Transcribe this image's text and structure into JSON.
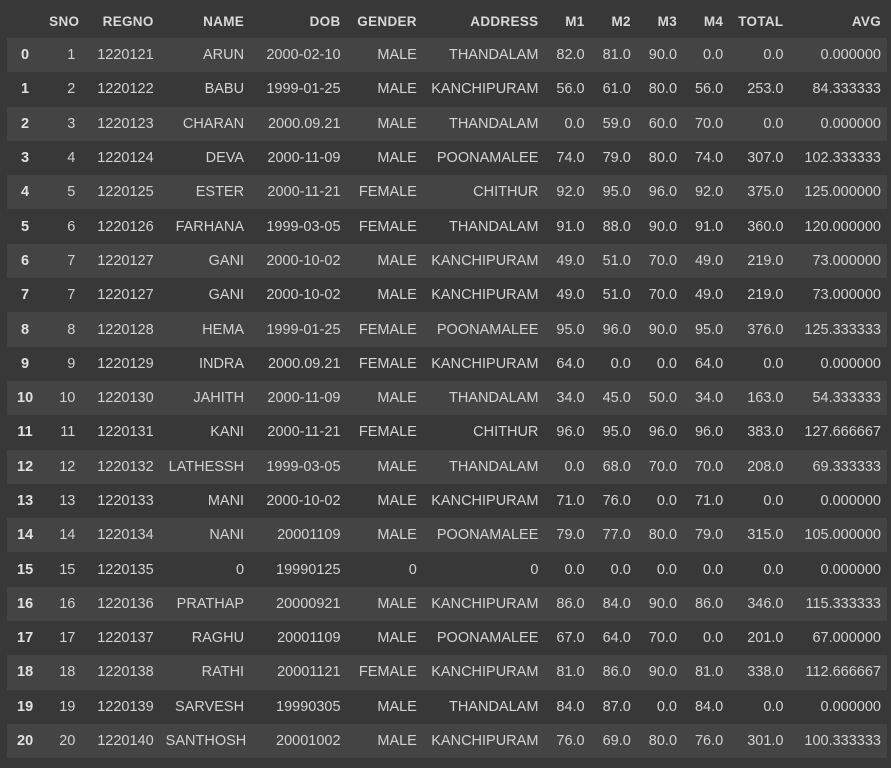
{
  "table": {
    "index_header": "",
    "columns": [
      "SNO",
      "REGNO",
      "NAME",
      "DOB",
      "GENDER",
      "ADDRESS",
      "M1",
      "M2",
      "M3",
      "M4",
      "TOTAL",
      "AVG"
    ],
    "rows": [
      {
        "index": "0",
        "cells": [
          "1",
          "1220121",
          "ARUN",
          "2000-02-10",
          "MALE",
          "THANDALAM",
          "82.0",
          "81.0",
          "90.0",
          "0.0",
          "0.0",
          "0.000000"
        ]
      },
      {
        "index": "1",
        "cells": [
          "2",
          "1220122",
          "BABU",
          "1999-01-25",
          "MALE",
          "KANCHIPURAM",
          "56.0",
          "61.0",
          "80.0",
          "56.0",
          "253.0",
          "84.333333"
        ]
      },
      {
        "index": "2",
        "cells": [
          "3",
          "1220123",
          "CHARAN",
          "2000.09.21",
          "MALE",
          "THANDALAM",
          "0.0",
          "59.0",
          "60.0",
          "70.0",
          "0.0",
          "0.000000"
        ]
      },
      {
        "index": "3",
        "cells": [
          "4",
          "1220124",
          "DEVA",
          "2000-11-09",
          "MALE",
          "POONAMALEE",
          "74.0",
          "79.0",
          "80.0",
          "74.0",
          "307.0",
          "102.333333"
        ]
      },
      {
        "index": "4",
        "cells": [
          "5",
          "1220125",
          "ESTER",
          "2000-11-21",
          "FEMALE",
          "CHITHUR",
          "92.0",
          "95.0",
          "96.0",
          "92.0",
          "375.0",
          "125.000000"
        ]
      },
      {
        "index": "5",
        "cells": [
          "6",
          "1220126",
          "FARHANA",
          "1999-03-05",
          "FEMALE",
          "THANDALAM",
          "91.0",
          "88.0",
          "90.0",
          "91.0",
          "360.0",
          "120.000000"
        ]
      },
      {
        "index": "6",
        "cells": [
          "7",
          "1220127",
          "GANI",
          "2000-10-02",
          "MALE",
          "KANCHIPURAM",
          "49.0",
          "51.0",
          "70.0",
          "49.0",
          "219.0",
          "73.000000"
        ]
      },
      {
        "index": "7",
        "cells": [
          "7",
          "1220127",
          "GANI",
          "2000-10-02",
          "MALE",
          "KANCHIPURAM",
          "49.0",
          "51.0",
          "70.0",
          "49.0",
          "219.0",
          "73.000000"
        ]
      },
      {
        "index": "8",
        "cells": [
          "8",
          "1220128",
          "HEMA",
          "1999-01-25",
          "FEMALE",
          "POONAMALEE",
          "95.0",
          "96.0",
          "90.0",
          "95.0",
          "376.0",
          "125.333333"
        ]
      },
      {
        "index": "9",
        "cells": [
          "9",
          "1220129",
          "INDRA",
          "2000.09.21",
          "FEMALE",
          "KANCHIPURAM",
          "64.0",
          "0.0",
          "0.0",
          "64.0",
          "0.0",
          "0.000000"
        ]
      },
      {
        "index": "10",
        "cells": [
          "10",
          "1220130",
          "JAHITH",
          "2000-11-09",
          "MALE",
          "THANDALAM",
          "34.0",
          "45.0",
          "50.0",
          "34.0",
          "163.0",
          "54.333333"
        ]
      },
      {
        "index": "11",
        "cells": [
          "11",
          "1220131",
          "KANI",
          "2000-11-21",
          "FEMALE",
          "CHITHUR",
          "96.0",
          "95.0",
          "96.0",
          "96.0",
          "383.0",
          "127.666667"
        ]
      },
      {
        "index": "12",
        "cells": [
          "12",
          "1220132",
          "LATHESSH",
          "1999-03-05",
          "MALE",
          "THANDALAM",
          "0.0",
          "68.0",
          "70.0",
          "70.0",
          "208.0",
          "69.333333"
        ]
      },
      {
        "index": "13",
        "cells": [
          "13",
          "1220133",
          "MANI",
          "2000-10-02",
          "MALE",
          "KANCHIPURAM",
          "71.0",
          "76.0",
          "0.0",
          "71.0",
          "0.0",
          "0.000000"
        ]
      },
      {
        "index": "14",
        "cells": [
          "14",
          "1220134",
          "NANI",
          "20001109",
          "MALE",
          "POONAMALEE",
          "79.0",
          "77.0",
          "80.0",
          "79.0",
          "315.0",
          "105.000000"
        ]
      },
      {
        "index": "15",
        "cells": [
          "15",
          "1220135",
          "0",
          "19990125",
          "0",
          "0",
          "0.0",
          "0.0",
          "0.0",
          "0.0",
          "0.0",
          "0.000000"
        ]
      },
      {
        "index": "16",
        "cells": [
          "16",
          "1220136",
          "PRATHAP",
          "20000921",
          "MALE",
          "KANCHIPURAM",
          "86.0",
          "84.0",
          "90.0",
          "86.0",
          "346.0",
          "115.333333"
        ]
      },
      {
        "index": "17",
        "cells": [
          "17",
          "1220137",
          "RAGHU",
          "20001109",
          "MALE",
          "POONAMALEE",
          "67.0",
          "64.0",
          "70.0",
          "0.0",
          "201.0",
          "67.000000"
        ]
      },
      {
        "index": "18",
        "cells": [
          "18",
          "1220138",
          "RATHI",
          "20001121",
          "FEMALE",
          "KANCHIPURAM",
          "81.0",
          "86.0",
          "90.0",
          "81.0",
          "338.0",
          "112.666667"
        ]
      },
      {
        "index": "19",
        "cells": [
          "19",
          "1220139",
          "SARVESH",
          "19990305",
          "MALE",
          "THANDALAM",
          "84.0",
          "87.0",
          "0.0",
          "84.0",
          "0.0",
          "0.000000"
        ]
      },
      {
        "index": "20",
        "cells": [
          "20",
          "1220140",
          "SANTHOSH",
          "20001002",
          "MALE",
          "KANCHIPURAM",
          "76.0",
          "69.0",
          "80.0",
          "76.0",
          "301.0",
          "100.333333"
        ]
      }
    ]
  },
  "colors": {
    "background": "#383838",
    "row_stripe": "#444444",
    "text": "#d2d2d2"
  }
}
